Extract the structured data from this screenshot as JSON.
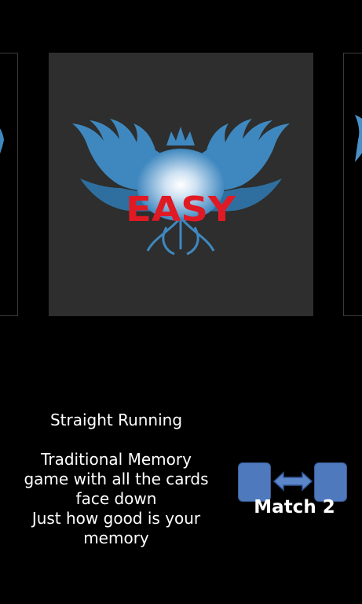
{
  "carousel": {
    "selected_card": {
      "badge_text": "EASY",
      "icon": "winged-crest-emblem"
    },
    "left_card_icon": "partial-card",
    "right_card_icon": "partial-card"
  },
  "mode": {
    "title": "Straight Running",
    "description": "Traditional Memory\ngame with all the cards\nface down\nJust how good is your\nmemory"
  },
  "match": {
    "label": "Match 2",
    "icon": "two-cards-swap-icon"
  },
  "colors": {
    "background": "#000000",
    "card_bg": "#2d2e2d",
    "wing_blue": "#3f88bf",
    "easy_red": "#e01a24",
    "card_icon_blue": "#4f79bd"
  }
}
